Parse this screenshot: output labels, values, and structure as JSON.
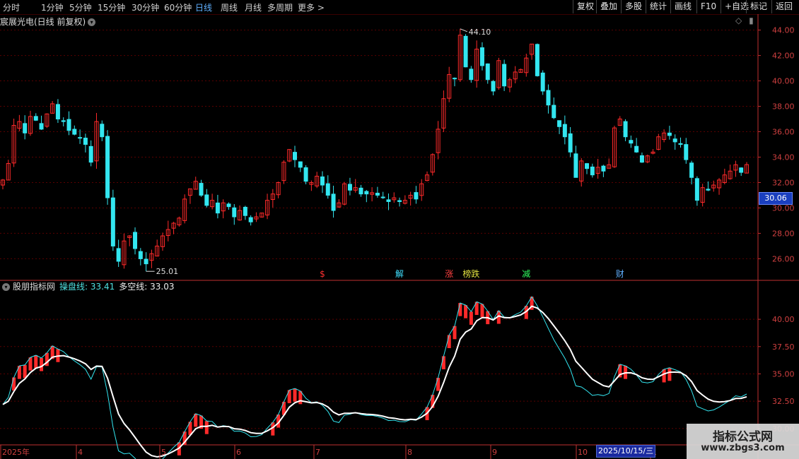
{
  "topbar": {
    "timeframes": [
      "分时",
      "1分钟",
      "5分钟",
      "15分钟",
      "30分钟",
      "60分钟",
      "日线",
      "周线",
      "月线",
      "多周期",
      "更多 >"
    ],
    "active": "日线",
    "buttons": [
      "复权",
      "叠加",
      "多股",
      "统计",
      "画线",
      "F10",
      "+自选",
      "标记",
      "返回"
    ]
  },
  "stock": {
    "title": "宸展光电(日线 前复权)"
  },
  "price_tag": "30.06",
  "annotations": {
    "high": "44.10",
    "low": "25.01"
  },
  "event_markers": [
    {
      "label": "$",
      "color": "#ff3030"
    },
    {
      "label": "解",
      "color": "#40e0ff"
    },
    {
      "label": "涨",
      "color": "#ff4040"
    },
    {
      "label": "榜跌",
      "color": "#e0e040"
    },
    {
      "label": "减",
      "color": "#30ff60"
    },
    {
      "label": "财",
      "color": "#60b0ff"
    }
  ],
  "indicator": {
    "name": "股朋指标网",
    "line1_label": "操盘线:",
    "line1_value": "33.41",
    "line2_label": "多空线:",
    "line2_value": "33.03"
  },
  "date_axis": [
    "2025年",
    "4",
    "5",
    "6",
    "7",
    "8",
    "9",
    "10",
    "1"
  ],
  "date_tag": "2025/10/15/三",
  "watermark": {
    "line1": "指标公式网",
    "line2": "www.zbgs3.com"
  },
  "colors": {
    "up": "#ff2a2a",
    "down": "#33e6f0",
    "grid": "#5a0000",
    "axis": "#c03030",
    "ma": "#ffffff"
  },
  "chart_data": [
    {
      "type": "candlestick",
      "title": "宸展光电(日线 前复权)",
      "y_ticks": [
        26.0,
        28.0,
        30.0,
        32.0,
        34.0,
        36.0,
        38.0,
        40.0,
        42.0,
        44.0
      ],
      "ylim": [
        24.3,
        44.7
      ],
      "x_month_labels": [
        "2025年",
        "4",
        "5",
        "6",
        "7",
        "8",
        "9",
        "10",
        "1"
      ],
      "closes": [
        32.2,
        33.5,
        36.5,
        36.8,
        35.9,
        37.2,
        36.9,
        36.2,
        37.4,
        38.2,
        37.0,
        36.8,
        36.1,
        35.8,
        35.5,
        35.0,
        33.6,
        36.8,
        35.6,
        30.8,
        27.0,
        25.8,
        27.4,
        27.8,
        26.8,
        26.0,
        25.6,
        26.4,
        27.0,
        27.8,
        28.3,
        28.8,
        29.2,
        30.7,
        31.5,
        32.1,
        31.0,
        30.2,
        30.6,
        29.6,
        30.4,
        30.1,
        29.3,
        29.8,
        29.4,
        28.9,
        29.3,
        29.6,
        30.6,
        31.1,
        32.0,
        33.6,
        34.6,
        33.8,
        33.2,
        32.1,
        32.0,
        32.5,
        31.8,
        31.0,
        29.8,
        30.4,
        31.9,
        31.4,
        31.6,
        31.1,
        31.1,
        31.2,
        31.0,
        30.8,
        30.5,
        30.8,
        30.5,
        30.6,
        31.0,
        30.7,
        31.9,
        32.6,
        34.2,
        36.2,
        38.6,
        40.5,
        40.2,
        43.6,
        41.1,
        40.1,
        42.5,
        41.2,
        40.1,
        39.2,
        41.6,
        39.6,
        40.1,
        40.7,
        40.9,
        41.8,
        42.9,
        40.4,
        39.2,
        38.1,
        37.1,
        36.4,
        35.6,
        34.4,
        32.4,
        33.7,
        33.1,
        32.6,
        33.2,
        32.9,
        33.4,
        36.3,
        37.0,
        35.6,
        35.1,
        34.4,
        33.6,
        34.1,
        34.4,
        35.6,
        35.9,
        35.7,
        35.2,
        35.0,
        33.8,
        32.4,
        30.6,
        31.6,
        31.4,
        31.8,
        32.2,
        32.6,
        32.9,
        33.4,
        32.8,
        33.41
      ],
      "series": [
        {
          "name": "操盘线",
          "values_last": 33.41
        },
        {
          "name": "多空线",
          "values_last": 33.03
        }
      ],
      "indicator_y_ticks": [
        30.0,
        32.5,
        35.0,
        37.5,
        40.0
      ],
      "indicator_ylim": [
        28.5,
        43.5
      ]
    }
  ]
}
